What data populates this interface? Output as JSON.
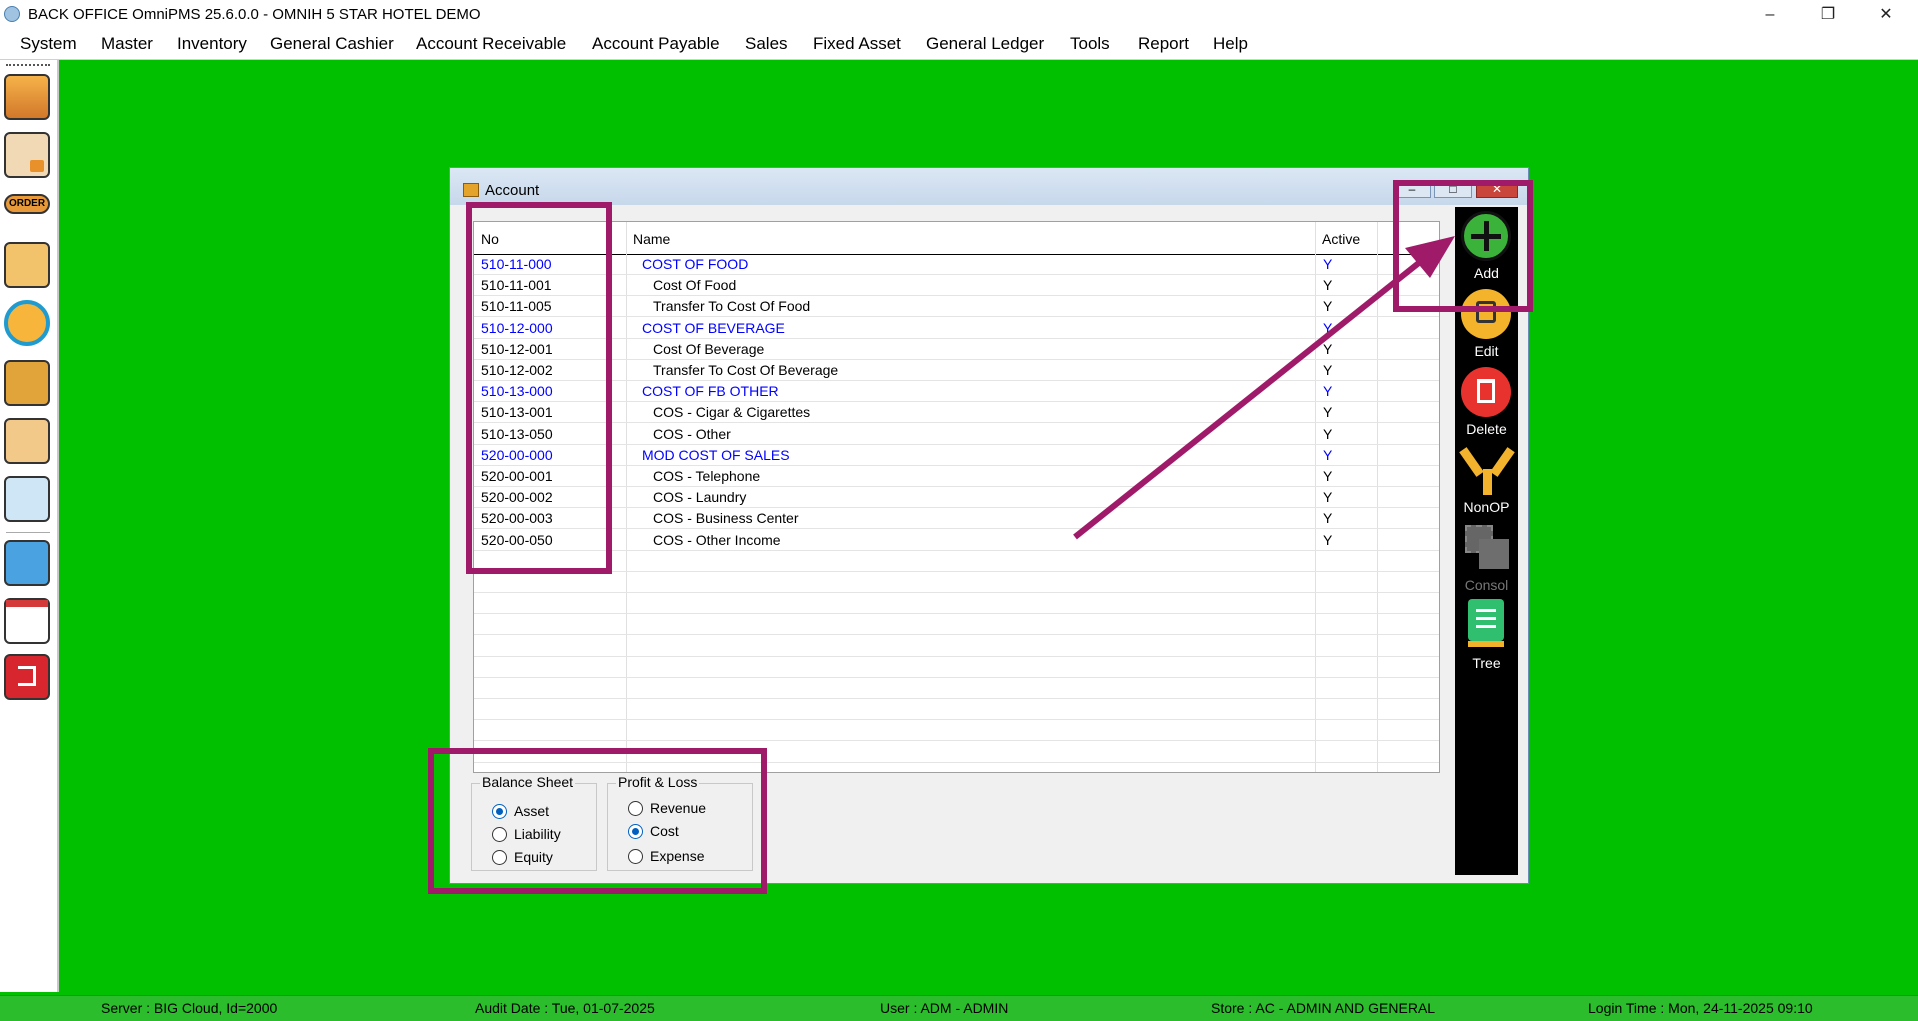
{
  "window": {
    "title": "BACK OFFICE OmniPMS 25.6.0.0 - OMNIH 5 STAR HOTEL DEMO",
    "minimize": "–",
    "restore": "❐",
    "close": "✕"
  },
  "menu": [
    "System",
    "Master",
    "Inventory",
    "General Cashier",
    "Account Receivable",
    "Account Payable",
    "Sales",
    "Fixed Asset",
    "General Ledger",
    "Tools",
    "Report",
    "Help"
  ],
  "toolbar_icons": [
    "boxes-icon",
    "clipboard-lock-icon",
    "order-icon",
    "cart-icon",
    "refresh-box-icon",
    "money-bags-icon",
    "hand-money-icon",
    "phone-touch-icon",
    "calendar-icon",
    "chart-icon",
    "exit-icon"
  ],
  "toolbar_order_label": "ORDER",
  "dialog": {
    "title": "Account",
    "columns": {
      "no": "No",
      "name": "Name",
      "active": "Active"
    },
    "rows": [
      {
        "no": "510-11-000",
        "name": "COST OF FOOD",
        "active": "Y",
        "header": true
      },
      {
        "no": "510-11-001",
        "name": "Cost Of Food",
        "active": "Y",
        "header": false
      },
      {
        "no": "510-11-005",
        "name": "Transfer To Cost Of Food",
        "active": "Y",
        "header": false
      },
      {
        "no": "510-12-000",
        "name": "COST OF BEVERAGE",
        "active": "Y",
        "header": true
      },
      {
        "no": "510-12-001",
        "name": "Cost Of Beverage",
        "active": "Y",
        "header": false
      },
      {
        "no": "510-12-002",
        "name": "Transfer To Cost Of Beverage",
        "active": "Y",
        "header": false
      },
      {
        "no": "510-13-000",
        "name": "COST OF FB OTHER",
        "active": "Y",
        "header": true
      },
      {
        "no": "510-13-001",
        "name": "COS - Cigar & Cigarettes",
        "active": "Y",
        "header": false
      },
      {
        "no": "510-13-050",
        "name": "COS - Other",
        "active": "Y",
        "header": false
      },
      {
        "no": "520-00-000",
        "name": "MOD COST OF SALES",
        "active": "Y",
        "header": true
      },
      {
        "no": "520-00-001",
        "name": "COS - Telephone",
        "active": "Y",
        "header": false
      },
      {
        "no": "520-00-002",
        "name": "COS - Laundry",
        "active": "Y",
        "header": false
      },
      {
        "no": "520-00-003",
        "name": "COS - Business Center",
        "active": "Y",
        "header": false
      },
      {
        "no": "520-00-050",
        "name": "COS - Other Income",
        "active": "Y",
        "header": false
      }
    ],
    "balance_sheet": {
      "label": "Balance Sheet",
      "options": [
        {
          "label": "Asset",
          "selected": true
        },
        {
          "label": "Liability",
          "selected": false
        },
        {
          "label": "Equity",
          "selected": false
        }
      ]
    },
    "profit_loss": {
      "label": "Profit & Loss",
      "options": [
        {
          "label": "Revenue",
          "selected": false
        },
        {
          "label": "Cost",
          "selected": true
        },
        {
          "label": "Expense",
          "selected": false
        }
      ]
    },
    "actions": {
      "add": "Add",
      "edit": "Edit",
      "delete": "Delete",
      "nonop": "NonOP",
      "consol": "Consol",
      "tree": "Tree"
    }
  },
  "status": {
    "server": "Server : BIG Cloud, Id=2000",
    "audit_date": "Audit Date : Tue, 01-07-2025",
    "user": "User : ADM - ADMIN",
    "store": "Store : AC - ADMIN AND GENERAL",
    "login_time": "Login Time : Mon, 24-11-2025 09:10"
  },
  "colors": {
    "desktop": "#00c000",
    "highlight": "#a01a6a",
    "header_row_text": "#0000ff"
  }
}
